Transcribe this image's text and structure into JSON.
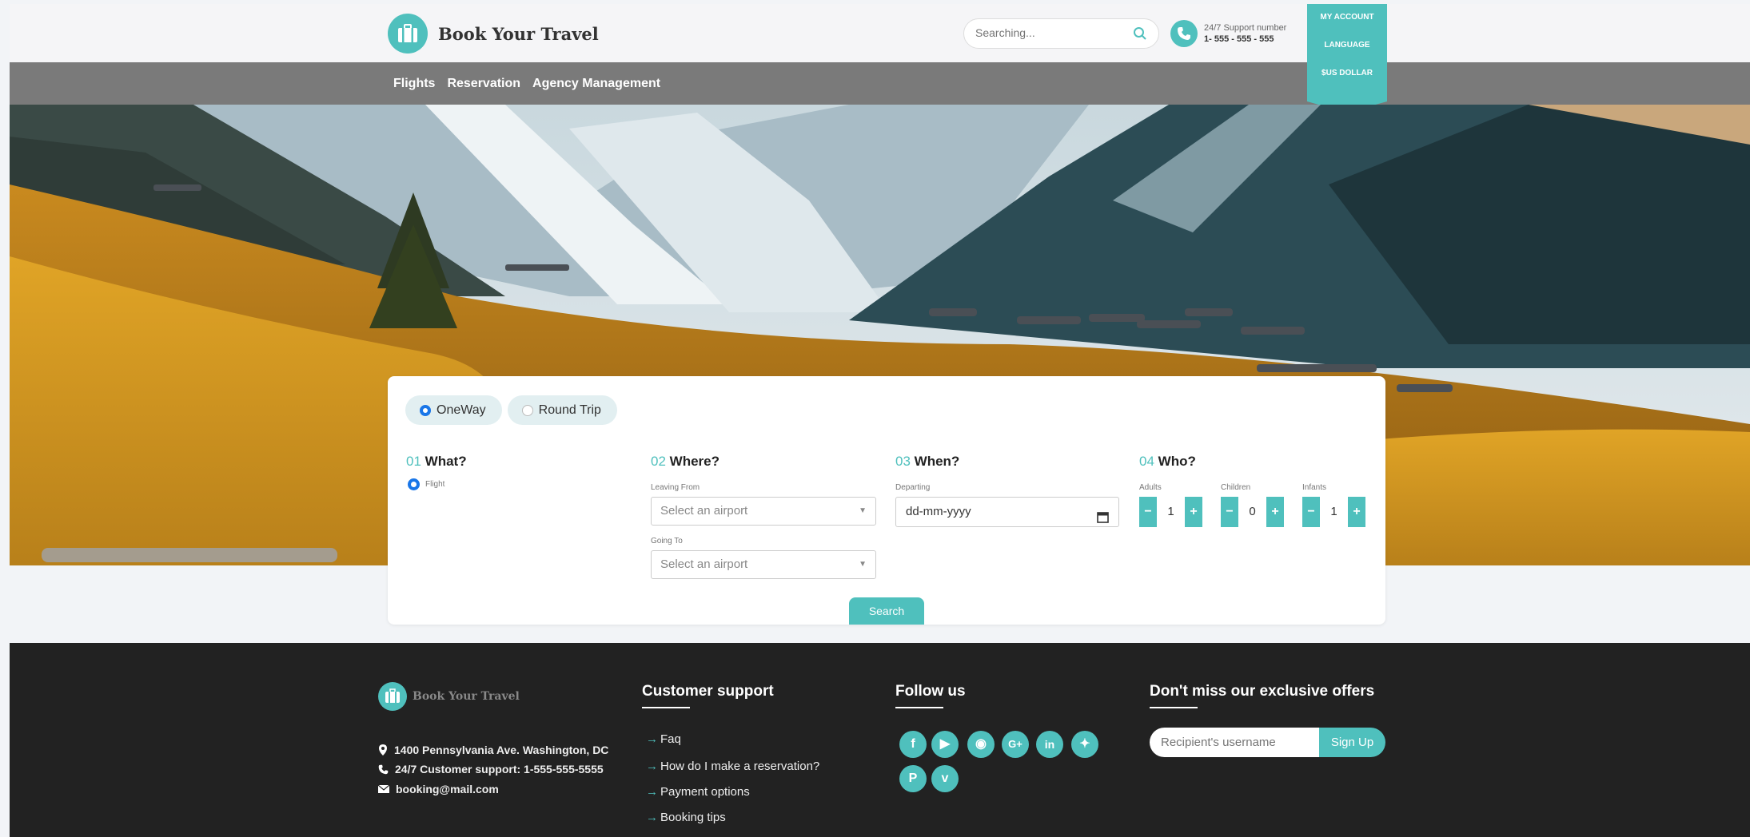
{
  "brand": {
    "name": "Book Your Travel",
    "accent": "#4fc0bd"
  },
  "search": {
    "placeholder": "Searching..."
  },
  "support": {
    "label": "24/7 Support number",
    "number": "1- 555 - 555 - 555"
  },
  "account_menu": {
    "my_account": "MY ACCOUNT",
    "language": "LANGUAGE",
    "currency": "$US DOLLAR"
  },
  "nav": {
    "items": [
      "Flights",
      "Reservation",
      "Agency Management"
    ]
  },
  "form": {
    "trip_types": {
      "oneway": "OneWay",
      "roundtrip": "Round Trip",
      "selected": "OneWay"
    },
    "what": {
      "num": "01",
      "title": "What?",
      "option": "Flight"
    },
    "where": {
      "num": "02",
      "title": "Where?",
      "leaving_label": "Leaving From",
      "leaving_value": "Select an airport",
      "going_label": "Going To",
      "going_value": "Select an airport"
    },
    "when": {
      "num": "03",
      "title": "When?",
      "departing_label": "Departing",
      "departing_value": "dd-mm-yyyy"
    },
    "who": {
      "num": "04",
      "title": "Who?",
      "adults_label": "Adults",
      "adults": "1",
      "children_label": "Children",
      "children": "0",
      "infants_label": "Infants",
      "infants": "1"
    },
    "search_button": "Search"
  },
  "footer": {
    "brand": "Book Your Travel",
    "address": "1400 Pennsylvania Ave. Washington, DC",
    "support": "24/7 Customer support: 1-555-555-5555",
    "email": "booking@mail.com",
    "customer_support": {
      "heading": "Customer support",
      "links": [
        "Faq",
        "How do I make a reservation?",
        "Payment options",
        "Booking tips"
      ]
    },
    "follow": {
      "heading": "Follow us",
      "icons": [
        "facebook-icon",
        "youtube-icon",
        "rss-icon",
        "google-plus-icon",
        "linkedin-icon",
        "twitter-icon",
        "pinterest-icon",
        "vimeo-icon"
      ]
    },
    "newsletter": {
      "heading": "Don't miss our exclusive offers",
      "placeholder": "Recipient's username",
      "button": "Sign Up"
    }
  }
}
